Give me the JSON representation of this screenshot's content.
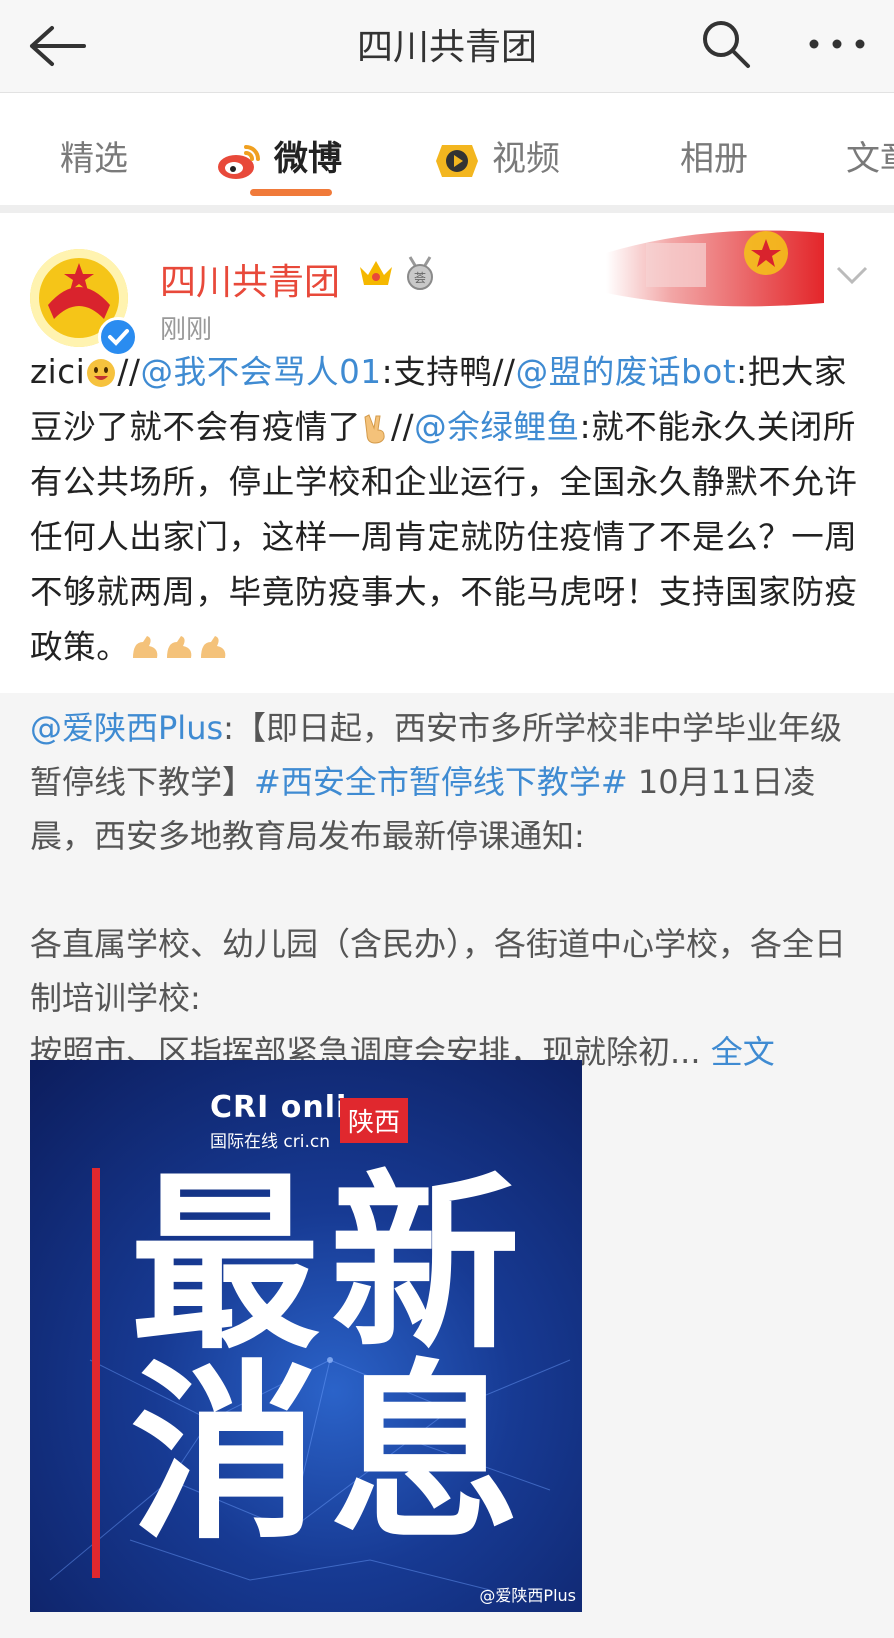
{
  "header": {
    "title": "四川共青团"
  },
  "tabs": [
    {
      "label": "精选"
    },
    {
      "label": "微博"
    },
    {
      "label": "视频"
    },
    {
      "label": "相册"
    },
    {
      "label": "文章"
    }
  ],
  "post": {
    "author": "四川共青团",
    "time": "刚刚",
    "text": {
      "p1": "zici",
      "p2": "//",
      "m1": "@我不会骂人01",
      "p3": ":支持鸭//",
      "m2": "@盟的废话bot",
      "p4": ":把大家豆沙了就不会有疫情了",
      "p5": "//",
      "m3": "@余绿鲤鱼",
      "p6": ":就不能永久关闭所有公共场所，停止学校和企业运行，全国永久静默不允许任何人出家门，这样一周肯定就防住疫情了不是么？一周不够就两周，毕竟防疫事大，不能马虎呀！支持国家防疫政策。"
    }
  },
  "repost": {
    "mention": "@爱陕西Plus",
    "r1": ":【即日起，西安市多所学校非中学毕业年级暂停线下教学】",
    "hashtag": "#西安全市暂停线下教学#",
    "r2": " 10月11日凌晨，西安多地教育局发布最新停课通知:",
    "r3": "各直属学校、幼儿园（含民办），各街道中心学校，各全日制培训学校:",
    "r4": "按照市、区指挥部紧急调度会安排，现就除初...",
    "full": "全文"
  },
  "image": {
    "logo_en": "CRI online",
    "logo_cn": "国际在线 cri.cn",
    "logo_tag": "陕西",
    "c1": "最",
    "c2": "新",
    "c3": "消",
    "c4": "息",
    "watermark": "@爱陕西Plus"
  },
  "colors": {
    "accent": "#f07a3a",
    "link": "#3f8bd2",
    "name": "#e8493a"
  }
}
